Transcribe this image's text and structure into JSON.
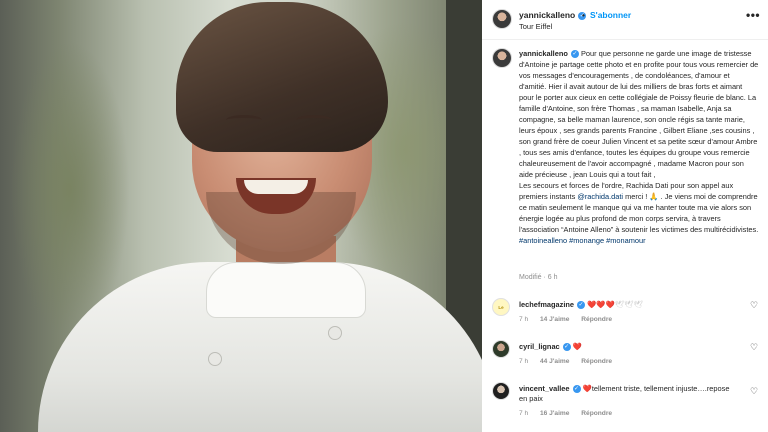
{
  "header": {
    "username": "yannickalleno",
    "separator": "•",
    "follow_label": "S'abonner",
    "location": "Tour Eiffel",
    "more_label": "•••"
  },
  "caption": {
    "username": "yannickalleno",
    "text_main": "Pour que personne ne garde une image de tristesse d'Antoine je partage cette photo et en profite pour tous vous remercier de vos messages d'encouragements , de condoléances, d'amour et d'amitié. Hier il avait autour de lui des milliers de bras forts et aimant pour le porter aux cieux en cette collégiale de Poissy fleurie de blanc. La famille d'Antoine, son frère Thomas , sa maman Isabelle, Anja sa compagne, sa belle maman laurence, son oncle régis sa tante marie, leurs époux , ses grands parents Francine , Gilbert Eliane ,ses cousins , son grand frère de coeur Julien Vincent et sa petite sœur d'amour Ambre , tous ses amis d'enfance, toutes les équipes du groupe vous remercie chaleureusement de l'avoir accompagné , madame Macron pour son aide précieuse , jean Louis qui a tout fait ,",
    "text_part2_a": "Les secours et forces de l'ordre, Rachida Dati pour son appel aux premiers instants",
    "mention": "@rachida.dati",
    "text_part2_b": "merci ! 🙏 . Je viens moi de comprendre ce matin seulement le manque qui va me hanter toute ma vie alors son énergie logée au plus profond de mon corps servira, à travers l'association “Antoine Alleno” à soutenir les victimes des multirécidivistes.",
    "hashtags": "#antoinealleno #monange #monamour",
    "edited": "Modifié · 6 h"
  },
  "comments": [
    {
      "username": "lechefmagazine",
      "avatar_text": "Le Chef",
      "emoji_red": "❤️❤️❤️",
      "emoji_pale": "🕊🕊🕊",
      "text": "",
      "time": "7 h",
      "likes": "14 J'aime",
      "reply": "Répondre",
      "heart": "♡"
    },
    {
      "username": "cyril_lignac",
      "avatar_text": "",
      "emoji_red": "❤️",
      "emoji_pale": "",
      "text": "",
      "time": "7 h",
      "likes": "44 J'aime",
      "reply": "Répondre",
      "heart": "♡"
    },
    {
      "username": "vincent_vallee",
      "avatar_text": "",
      "emoji_red": "❤️",
      "emoji_pale": "",
      "text": "tellement triste, tellement injuste….repose en paix",
      "time": "7 h",
      "likes": "16 J'aime",
      "reply": "Répondre",
      "heart": "♡"
    }
  ],
  "colors": {
    "follow_blue": "#0095f6",
    "verified_blue": "#3897f0",
    "mention_blue": "#00376b",
    "heart_red": "#ed4956",
    "meta_gray": "#8e8e8e"
  }
}
